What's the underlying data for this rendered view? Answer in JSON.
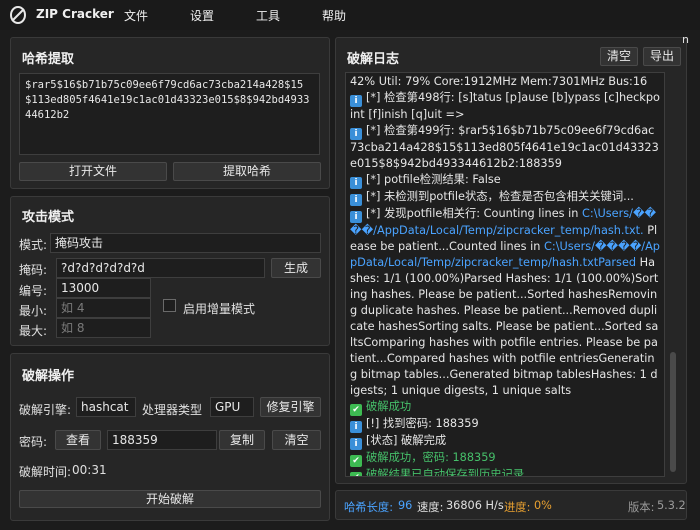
{
  "app": {
    "title": "ZIP Cracker",
    "logo_icon": "zip-cracker-logo"
  },
  "menu": {
    "file": "文件",
    "settings": "设置",
    "tools": "工具",
    "help": "帮助"
  },
  "hash_panel": {
    "title": "哈希提取",
    "hash_value": "$rar5$16$b71b75c09ee6f79cd6ac73cba214a428$15$113ed805f4641e19c1ac01d43323e015$8$942bd493344612b2",
    "open_file": "打开文件",
    "extract_hash": "提取哈希"
  },
  "attack_panel": {
    "title": "攻击模式",
    "mode_label": "模式:",
    "mode_value": "掩码攻击",
    "mask_label": "掩码:",
    "mask_value": "?d?d?d?d?d?d",
    "generate": "生成",
    "code_label": "编号:",
    "code_value": "13000",
    "min_label": "最小:",
    "min_placeholder": "如 4",
    "increment_label": "启用增量模式",
    "max_label": "最大:",
    "max_placeholder": "如 8"
  },
  "crack_panel": {
    "title": "破解操作",
    "engine_label": "破解引擎:",
    "engine_value": "hashcat",
    "processor_label": "处理器类型",
    "processor_value": "GPU",
    "repair_engine": "修复引擎",
    "password_label": "密码:",
    "view": "查看",
    "password_value": "188359",
    "copy": "复制",
    "clear": "清空",
    "time_label": "破解时间:",
    "time_value": "00:31",
    "start": "开始破解"
  },
  "log_panel": {
    "title": "破解日志",
    "clear": "清空",
    "export": "导出",
    "corner_char": "n",
    "lines": [
      {
        "icon": "",
        "text": "42% Util: 79% Core:1912MHz Mem:7301MHz Bus:16"
      },
      {
        "icon": "info",
        "text": "[*] 检查第498行: [s]tatus [p]ause [b]ypass [c]heckpoint [f]inish [q]uit =>"
      },
      {
        "icon": "info",
        "text": "[*] 检查第499行: $rar5$16$b71b75c09ee6f79cd6ac73cba214a428$15$113ed805f4641e19c1ac01d43323e015$8$942bd493344612b2:188359"
      },
      {
        "icon": "info",
        "text": "[*] potfile检测结果: False"
      },
      {
        "icon": "info",
        "text": "[*] 未检测到potfile状态，检查是否包含相关关键词..."
      },
      {
        "icon": "info",
        "text": "[*] 发现potfile相关行: Counting lines in ",
        "link": "C:\\Users/����/AppData/Local/Temp/zipcracker_temp/hash.txt.",
        "after": " Please be patient...Counted lines in ",
        "link2": "C:\\Users/����/AppData/Local/Temp/zipcracker_temp/hash.txtParsed",
        "after2": " Hashes: 1/1 (100.00%)Parsed Hashes: 1/1 (100.00%)Sorting hashes. Please be patient...Sorted hashesRemoving duplicate hashes. Please be patient...Removed duplicate hashesSorting salts. Please be patient...Sorted saltsComparing hashes with potfile entries. Please be patient...Compared hashes with potfile entriesGenerating bitmap tables...Generated bitmap tablesHashes: 1 digests; 1 unique digests, 1 unique salts"
      },
      {
        "icon": "ok",
        "text": "破解成功",
        "color": "green"
      },
      {
        "icon": "info",
        "text": "[!] 找到密码: 188359"
      },
      {
        "icon": "info",
        "text": "[状态] 破解完成"
      },
      {
        "icon": "ok",
        "text": "破解成功，密码: 188359",
        "color": "green"
      },
      {
        "icon": "ok",
        "text": "破解结果已自动保存到历史记录",
        "color": "green"
      }
    ]
  },
  "status": {
    "hash_length_label": "哈希长度:",
    "hash_length": "96",
    "speed_label": "速度:",
    "speed": "36806 H/s",
    "progress_label": "进度:",
    "progress": "0%",
    "version_label": "版本:",
    "version": "5.3.2"
  },
  "colors": {
    "info": "#3a8fd8",
    "success": "#46c06a",
    "link": "#4aa3ff",
    "progress": "#e8a030",
    "hash_length": "#4aa3ff"
  }
}
